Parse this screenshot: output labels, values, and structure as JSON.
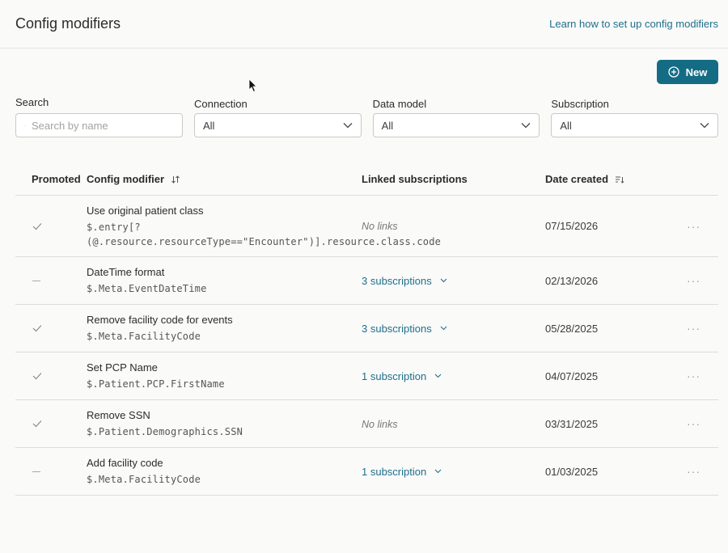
{
  "header": {
    "title": "Config modifiers",
    "help_link": "Learn how to set up config modifiers"
  },
  "toolbar": {
    "new_label": "New"
  },
  "filters": {
    "search": {
      "label": "Search",
      "placeholder": "Search by name",
      "value": ""
    },
    "connection": {
      "label": "Connection",
      "value": "All"
    },
    "data_model": {
      "label": "Data model",
      "value": "All"
    },
    "subscription": {
      "label": "Subscription",
      "value": "All"
    }
  },
  "table": {
    "columns": {
      "promoted": "Promoted",
      "config_modifier": "Config modifier",
      "linked_subscriptions": "Linked subscriptions",
      "date_created": "Date created"
    },
    "rows": [
      {
        "promoted": true,
        "name": "Use original patient class",
        "path_line1": "$.entry[?",
        "path_line2": "(@.resource.resourceType==\"Encounter\")].resource.class.code",
        "linked": "No links",
        "has_links": false,
        "date": "07/15/2026",
        "more": "···"
      },
      {
        "promoted": false,
        "name": "DateTime format",
        "path_line1": "$.Meta.EventDateTime",
        "path_line2": "",
        "linked": "3 subscriptions",
        "has_links": true,
        "date": "02/13/2026",
        "more": "···"
      },
      {
        "promoted": true,
        "name": "Remove facility code for events",
        "path_line1": "$.Meta.FacilityCode",
        "path_line2": "",
        "linked": "3 subscriptions",
        "has_links": true,
        "date": "05/28/2025",
        "more": "···"
      },
      {
        "promoted": true,
        "name": "Set PCP Name",
        "path_line1": "$.Patient.PCP.FirstName",
        "path_line2": "",
        "linked": "1 subscription",
        "has_links": true,
        "date": "04/07/2025",
        "more": "···"
      },
      {
        "promoted": true,
        "name": "Remove SSN",
        "path_line1": "$.Patient.Demographics.SSN",
        "path_line2": "",
        "linked": "No links",
        "has_links": false,
        "date": "03/31/2025",
        "more": "···"
      },
      {
        "promoted": false,
        "name": "Add facility code",
        "path_line1": "$.Meta.FacilityCode",
        "path_line2": "",
        "linked": "1 subscription",
        "has_links": true,
        "date": "01/03/2025",
        "more": "···"
      }
    ]
  },
  "colors": {
    "accent": "#146c84",
    "link": "#1f6f8b",
    "background": "#fafaf9"
  }
}
